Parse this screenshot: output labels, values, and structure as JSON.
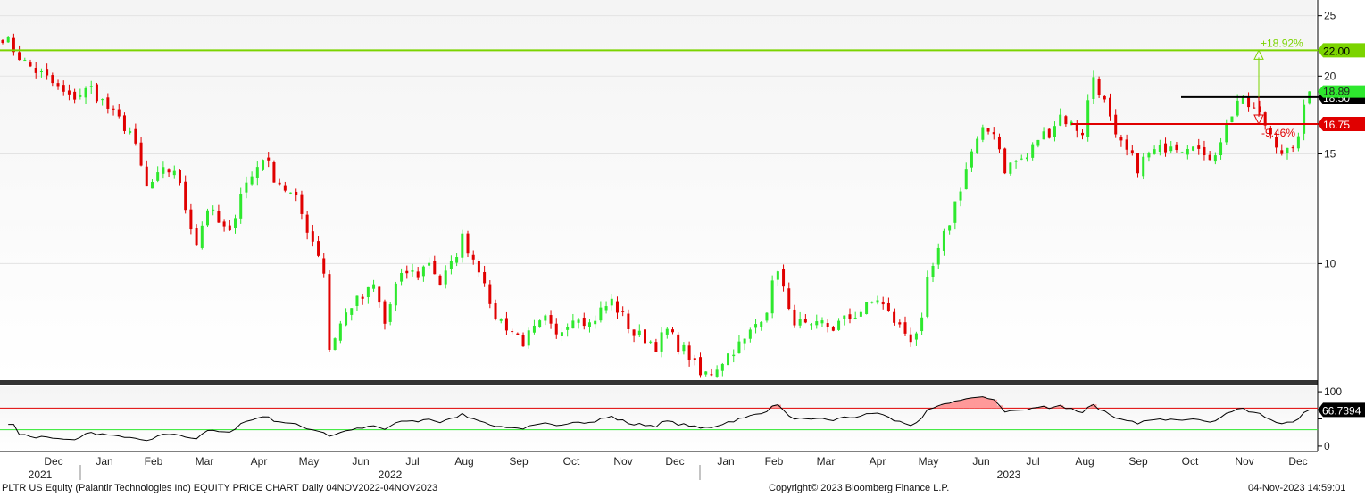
{
  "chart_data": [
    {
      "type": "candlestick",
      "title": "PLTR US Equity (Palantir Technologies Inc) EQUITY PRICE CHART",
      "ylim": [
        6.5,
        26.5
      ],
      "yticks": [
        10,
        15,
        20,
        25
      ],
      "x_months": [
        "Dec",
        "Jan",
        "Feb",
        "Mar",
        "Apr",
        "May",
        "Jun",
        "Jul",
        "Aug",
        "Sep",
        "Oct",
        "Nov",
        "Dec",
        "Jan",
        "Feb",
        "Mar",
        "Apr",
        "May",
        "Jun",
        "Jul",
        "Aug",
        "Sep",
        "Oct",
        "Nov",
        "Dec"
      ],
      "x_years": [
        "2021",
        "2022",
        "2023"
      ],
      "colors": {
        "up": "#2ee82e",
        "down": "#e00000",
        "upper_line": "#7bd400",
        "target_line": "#000000",
        "lower_line": "#e00000"
      },
      "close_path": [
        [
          0,
          23.2
        ],
        [
          4,
          21.0
        ],
        [
          8,
          19.8
        ],
        [
          12,
          18.4
        ],
        [
          16,
          19.1
        ],
        [
          20,
          17.3
        ],
        [
          23,
          16.3
        ],
        [
          26,
          13.2
        ],
        [
          29,
          14.0
        ],
        [
          31,
          14.2
        ],
        [
          33,
          12.3
        ],
        [
          35,
          10.8
        ],
        [
          37,
          12.3
        ],
        [
          39,
          11.6
        ],
        [
          41,
          11.1
        ],
        [
          43,
          13.1
        ],
        [
          45,
          13.8
        ],
        [
          47,
          14.9
        ],
        [
          49,
          13.8
        ],
        [
          51,
          13.2
        ],
        [
          53,
          12.6
        ],
        [
          55,
          11.4
        ],
        [
          57,
          10.4
        ],
        [
          58,
          9.7
        ],
        [
          59,
          7.3
        ],
        [
          61,
          8.0
        ],
        [
          63,
          8.6
        ],
        [
          65,
          8.8
        ],
        [
          67,
          9.2
        ],
        [
          69,
          8.0
        ],
        [
          71,
          9.2
        ],
        [
          73,
          9.7
        ],
        [
          75,
          9.6
        ],
        [
          77,
          10.1
        ],
        [
          79,
          9.3
        ],
        [
          81,
          9.9
        ],
        [
          83,
          11.0
        ],
        [
          85,
          10.2
        ],
        [
          87,
          9.5
        ],
        [
          88,
          8.4
        ],
        [
          90,
          8.1
        ],
        [
          92,
          7.8
        ],
        [
          94,
          7.5
        ],
        [
          96,
          7.8
        ],
        [
          98,
          8.1
        ],
        [
          100,
          7.6
        ],
        [
          102,
          8.1
        ],
        [
          104,
          8.3
        ],
        [
          106,
          8.0
        ],
        [
          108,
          8.4
        ],
        [
          110,
          8.7
        ],
        [
          112,
          8.2
        ],
        [
          114,
          7.7
        ],
        [
          116,
          7.6
        ],
        [
          118,
          7.4
        ],
        [
          120,
          7.8
        ],
        [
          122,
          7.4
        ],
        [
          124,
          7.1
        ],
        [
          126,
          6.6
        ],
        [
          128,
          6.7
        ],
        [
          130,
          7.0
        ],
        [
          132,
          7.3
        ],
        [
          134,
          7.5
        ],
        [
          136,
          8.0
        ],
        [
          138,
          8.5
        ],
        [
          140,
          9.9
        ],
        [
          142,
          8.3
        ],
        [
          144,
          8.0
        ],
        [
          146,
          7.8
        ],
        [
          148,
          8.0
        ],
        [
          150,
          7.9
        ],
        [
          152,
          8.1
        ],
        [
          154,
          8.3
        ],
        [
          156,
          8.5
        ],
        [
          158,
          8.8
        ],
        [
          160,
          8.3
        ],
        [
          162,
          7.9
        ],
        [
          164,
          7.6
        ],
        [
          166,
          8.0
        ],
        [
          167,
          9.3
        ],
        [
          169,
          10.4
        ],
        [
          171,
          11.7
        ],
        [
          173,
          13.3
        ],
        [
          175,
          15.1
        ],
        [
          177,
          16.2
        ],
        [
          179,
          16.4
        ],
        [
          181,
          14.2
        ],
        [
          183,
          14.6
        ],
        [
          185,
          14.8
        ],
        [
          187,
          15.9
        ],
        [
          189,
          16.3
        ],
        [
          191,
          17.3
        ],
        [
          193,
          16.7
        ],
        [
          195,
          16.3
        ],
        [
          197,
          20.0
        ],
        [
          199,
          18.1
        ],
        [
          201,
          15.8
        ],
        [
          203,
          15.1
        ],
        [
          205,
          14.3
        ],
        [
          207,
          15.0
        ],
        [
          209,
          15.2
        ],
        [
          211,
          15.7
        ],
        [
          213,
          15.4
        ],
        [
          215,
          15.8
        ],
        [
          217,
          14.6
        ],
        [
          219,
          15.2
        ],
        [
          221,
          16.6
        ],
        [
          223,
          18.3
        ],
        [
          225,
          17.9
        ],
        [
          227,
          17.3
        ],
        [
          229,
          16.2
        ],
        [
          231,
          15.2
        ],
        [
          233,
          15.0
        ],
        [
          236,
          18.9
        ]
      ],
      "n_bars": 237,
      "horizontal_lines": [
        {
          "value": 22.0,
          "label": "22.00",
          "color": "#7bd400"
        },
        {
          "value": 18.5,
          "label": "18.50",
          "color": "#000000"
        },
        {
          "value": 16.75,
          "label": "16.75",
          "color": "#e00000"
        }
      ],
      "last_price_label": "18.89",
      "annotations": [
        {
          "text": "+18.92%",
          "color": "#7bd400"
        },
        {
          "text": "-9.46%",
          "color": "#e00000"
        }
      ]
    },
    {
      "type": "line",
      "name": "RSI",
      "ylim": [
        -10,
        110
      ],
      "yticks": [
        0,
        50,
        100
      ],
      "ytick_labels": [
        "0",
        "",
        "100"
      ],
      "overbought": 70,
      "oversold": 30,
      "last_value_label": "66.7394",
      "colors": {
        "line": "#000000",
        "upper": "#e00000",
        "lower": "#2ee82e",
        "fill": "#ff9999"
      }
    }
  ],
  "footer": {
    "left": "PLTR US Equity (Palantir Technologies Inc) EQUITY PRICE CHART  Daily 04NOV2022-04NOV2023",
    "center": "Copyright© 2023 Bloomberg Finance L.P.",
    "right": "04-Nov-2023 14:59:01"
  }
}
